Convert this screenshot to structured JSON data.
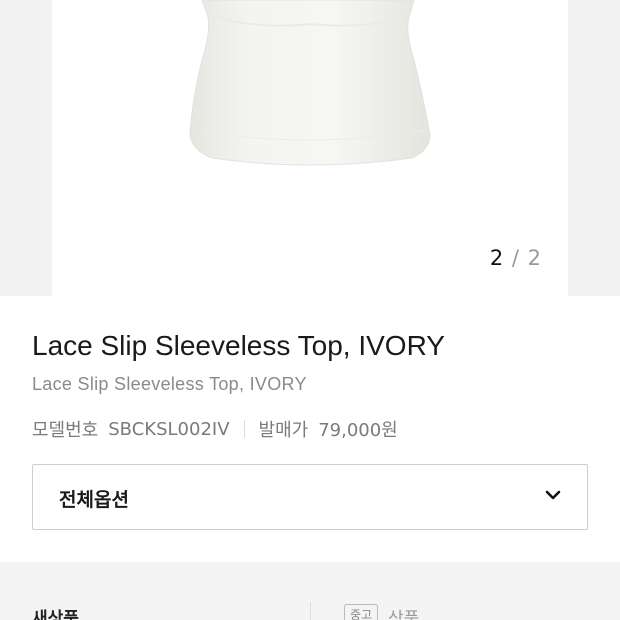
{
  "gallery": {
    "current_page": "2",
    "separator": " / ",
    "total_pages": "2"
  },
  "product": {
    "title": "Lace Slip Sleeveless Top, IVORY",
    "subtitle": "Lace Slip Sleeveless Top, IVORY",
    "model_label": "모델번호",
    "model_value": "SBCKSL002IV",
    "price_label": "발매가",
    "price_value": "79,000원"
  },
  "options": {
    "label": "전체옵션"
  },
  "tabs": {
    "new_label": "새상품",
    "used_badge": "중고",
    "used_label": "상품"
  }
}
